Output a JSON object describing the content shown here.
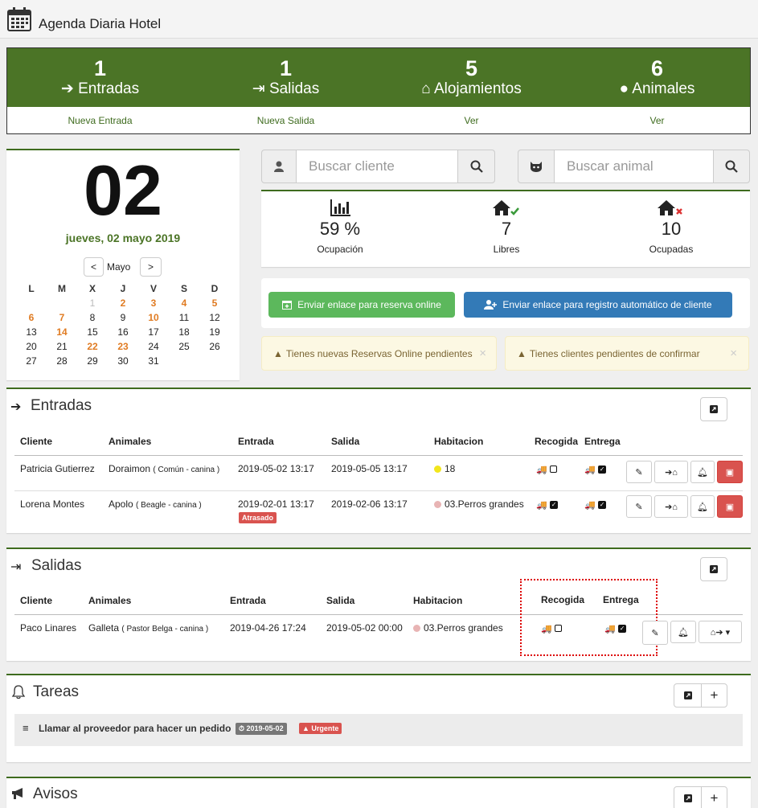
{
  "app": {
    "title": "Agenda Diaria Hotel"
  },
  "stats": [
    {
      "num": "1",
      "label": "Entradas",
      "link": "Nueva Entrada"
    },
    {
      "num": "1",
      "label": "Salidas",
      "link": "Nueva Salida"
    },
    {
      "num": "5",
      "label": "Alojamientos",
      "link": "Ver"
    },
    {
      "num": "6",
      "label": "Animales",
      "link": "Ver"
    }
  ],
  "calendar": {
    "day": "02",
    "date_text": "jueves, 02 mayo 2019",
    "month": "Mayo",
    "prev": "<",
    "next": ">",
    "weekdays": [
      "L",
      "M",
      "X",
      "J",
      "V",
      "S",
      "D"
    ],
    "weeks": [
      [
        "",
        "",
        "1",
        "2",
        "3",
        "4",
        "5"
      ],
      [
        "6",
        "7",
        "8",
        "9",
        "10",
        "11",
        "12"
      ],
      [
        "13",
        "14",
        "15",
        "16",
        "17",
        "18",
        "19"
      ],
      [
        "20",
        "21",
        "22",
        "23",
        "24",
        "25",
        "26"
      ],
      [
        "27",
        "28",
        "29",
        "30",
        "31",
        "",
        ""
      ]
    ],
    "highlighted": [
      "2",
      "3",
      "4",
      "5",
      "6",
      "7",
      "10",
      "14",
      "22",
      "23"
    ],
    "muted": [
      "1"
    ]
  },
  "search": {
    "client_placeholder": "Buscar cliente",
    "animal_placeholder": "Buscar animal"
  },
  "occupancy": [
    {
      "value": "59 %",
      "label": "Ocupación"
    },
    {
      "value": "7",
      "label": "Libres"
    },
    {
      "value": "10",
      "label": "Ocupadas"
    }
  ],
  "actions": {
    "online_booking": "Enviar enlace para reserva online",
    "auto_register": "Enviar enlace para registro automático de cliente"
  },
  "alerts": [
    {
      "text": "Tienes nuevas Reservas Online pendientes"
    },
    {
      "text": "Tienes clientes pendientes de confirmar"
    }
  ],
  "entradas": {
    "title": "Entradas",
    "columns": [
      "Cliente",
      "Animales",
      "Entrada",
      "Salida",
      "Habitacion",
      "Recogida",
      "Entrega"
    ],
    "rows": [
      {
        "cliente": "Patricia Gutierrez",
        "animal": "Doraimon",
        "animal_detail": "( Común - canina )",
        "entrada": "2019-05-02 13:17",
        "salida": "2019-05-05 13:17",
        "habitacion": "18",
        "dot": "#f2e61c",
        "badge": ""
      },
      {
        "cliente": "Lorena Montes",
        "animal": "Apolo",
        "animal_detail": "( Beagle - canina )",
        "entrada": "2019-02-01 13:17",
        "salida": "2019-02-06 13:17",
        "habitacion": "03.Perros grandes",
        "dot": "#e8b4b4",
        "badge": "Atrasado"
      }
    ]
  },
  "salidas": {
    "title": "Salidas",
    "columns": [
      "Cliente",
      "Animales",
      "Entrada",
      "Salida",
      "Habitacion",
      "Recogida",
      "Entrega"
    ],
    "rows": [
      {
        "cliente": "Paco Linares",
        "animal": "Galleta",
        "animal_detail": "( Pastor Belga - canina )",
        "entrada": "2019-04-26 17:24",
        "salida": "2019-05-02 00:00",
        "habitacion": "03.Perros grandes",
        "dot": "#e8b4b4"
      }
    ]
  },
  "tareas": {
    "title": "Tareas",
    "items": [
      {
        "text": "Llamar al proveedor para hacer un pedido",
        "date": "2019-05-02",
        "priority": "Urgente"
      }
    ]
  },
  "avisos": {
    "title": "Avisos"
  },
  "colors": {
    "brand": "#4b7426",
    "accent_orange": "#e07b22",
    "danger": "#d9534f",
    "primary": "#337ab7",
    "success": "#5cb85c"
  }
}
